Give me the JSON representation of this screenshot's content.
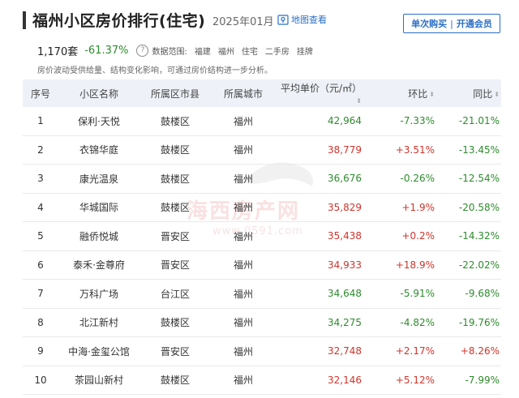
{
  "header": {
    "title": "福州小区房价排行(住宅)",
    "date": "2025年01月",
    "map_link": "地图查看",
    "btn_single": "单次购买",
    "btn_sep": "|",
    "btn_member": "开通会员"
  },
  "summary": {
    "count": "1,170套",
    "change": "-61.37%",
    "scope_label": "数据范围:",
    "scope_tags": [
      "福建",
      "福州",
      "住宅",
      "二手房",
      "挂牌"
    ]
  },
  "note": "房价波动受供给量、结构变化影响，可通过房价结构进一步分析。",
  "table": {
    "headers": [
      "序号",
      "小区名称",
      "所属区市县",
      "所属城市",
      "平均单价（元/㎡）",
      "环比",
      "同比"
    ],
    "rows": [
      {
        "idx": "1",
        "name": "保利·天悦",
        "district": "鼓楼区",
        "city": "福州",
        "price": "42,964",
        "mom": "-7.33%",
        "yoy": "-21.01%"
      },
      {
        "idx": "2",
        "name": "衣锦华庭",
        "district": "鼓楼区",
        "city": "福州",
        "price": "38,779",
        "mom": "+3.51%",
        "yoy": "-13.45%"
      },
      {
        "idx": "3",
        "name": "康光温泉",
        "district": "鼓楼区",
        "city": "福州",
        "price": "36,676",
        "mom": "-0.26%",
        "yoy": "-12.54%"
      },
      {
        "idx": "4",
        "name": "华城国际",
        "district": "鼓楼区",
        "city": "福州",
        "price": "35,829",
        "mom": "+1.9%",
        "yoy": "-20.58%"
      },
      {
        "idx": "5",
        "name": "融侨悦城",
        "district": "晋安区",
        "city": "福州",
        "price": "35,438",
        "mom": "+0.2%",
        "yoy": "-14.32%"
      },
      {
        "idx": "6",
        "name": "泰禾·金尊府",
        "district": "晋安区",
        "city": "福州",
        "price": "34,933",
        "mom": "+18.9%",
        "yoy": "-22.02%"
      },
      {
        "idx": "7",
        "name": "万科广场",
        "district": "台江区",
        "city": "福州",
        "price": "34,648",
        "mom": "-5.91%",
        "yoy": "-9.68%"
      },
      {
        "idx": "8",
        "name": "北江新村",
        "district": "鼓楼区",
        "city": "福州",
        "price": "34,275",
        "mom": "-4.82%",
        "yoy": "-19.76%"
      },
      {
        "idx": "9",
        "name": "中海·金玺公馆",
        "district": "晋安区",
        "city": "福州",
        "price": "32,748",
        "mom": "+2.17%",
        "yoy": "+8.26%"
      },
      {
        "idx": "10",
        "name": "茶园山新村",
        "district": "鼓楼区",
        "city": "福州",
        "price": "32,146",
        "mom": "+5.12%",
        "yoy": "-7.99%"
      }
    ]
  },
  "watermark": {
    "text": "海西房产网",
    "url": "www.0591.com"
  },
  "colors": {
    "accent": "#2b6fc7",
    "up": "#d0342c",
    "down": "#2e8b2e",
    "header_bg": "#eef2f8"
  }
}
